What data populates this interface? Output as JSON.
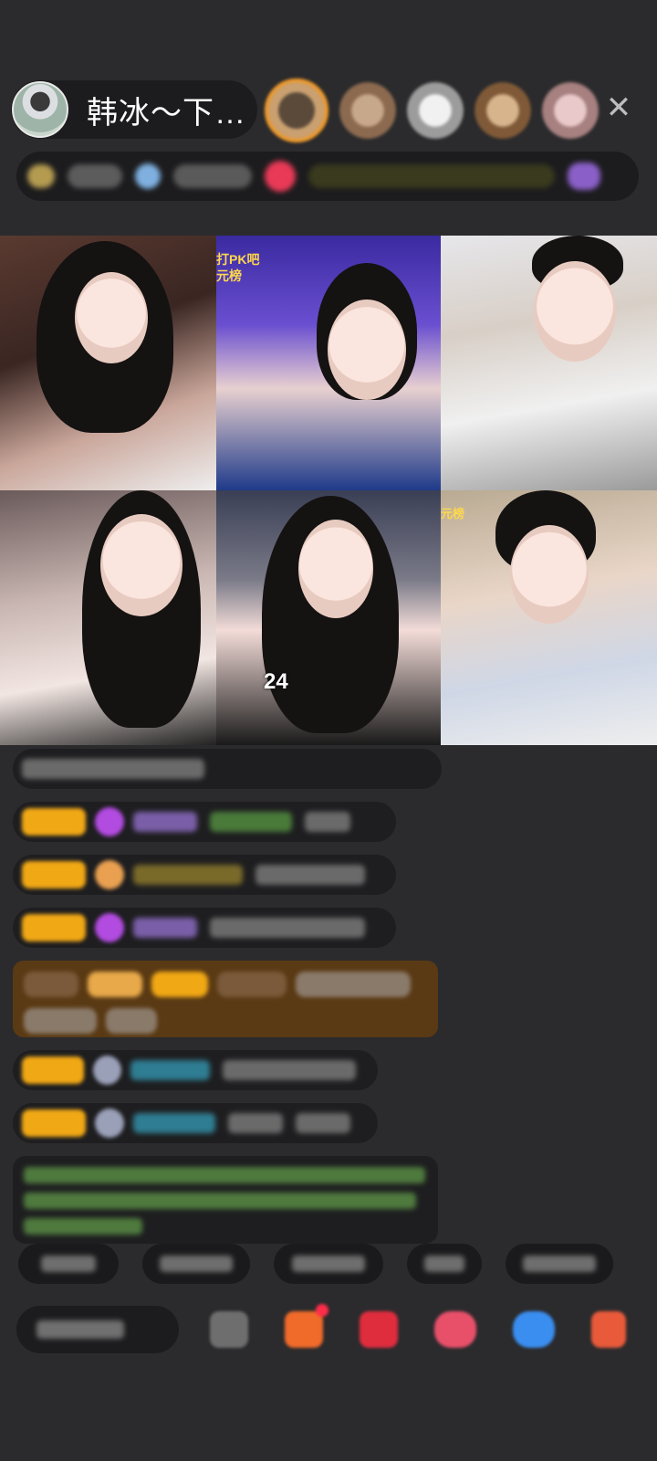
{
  "host": {
    "name": "韩冰～下…"
  },
  "top": {
    "close_icon": "close-icon",
    "viewer_count_visible": 5
  },
  "video_grid": {
    "tile2_overlay_line1": "打PK吧",
    "tile2_overlay_line2": "元榜",
    "tile5_number": "24",
    "tile6_overlay": "元榜"
  },
  "chat": {
    "messages": [
      {
        "type": "blurred"
      },
      {
        "type": "blurred"
      },
      {
        "type": "blurred"
      },
      {
        "type": "blurred"
      },
      {
        "type": "blurred-gift"
      },
      {
        "type": "blurred"
      },
      {
        "type": "blurred"
      },
      {
        "type": "blurred-system"
      }
    ]
  },
  "bottom": {
    "icons": [
      "message-icon",
      "gift-box-icon",
      "red-packet-icon",
      "pink-chat-icon",
      "blue-chat-icon",
      "grid-menu-icon"
    ]
  }
}
